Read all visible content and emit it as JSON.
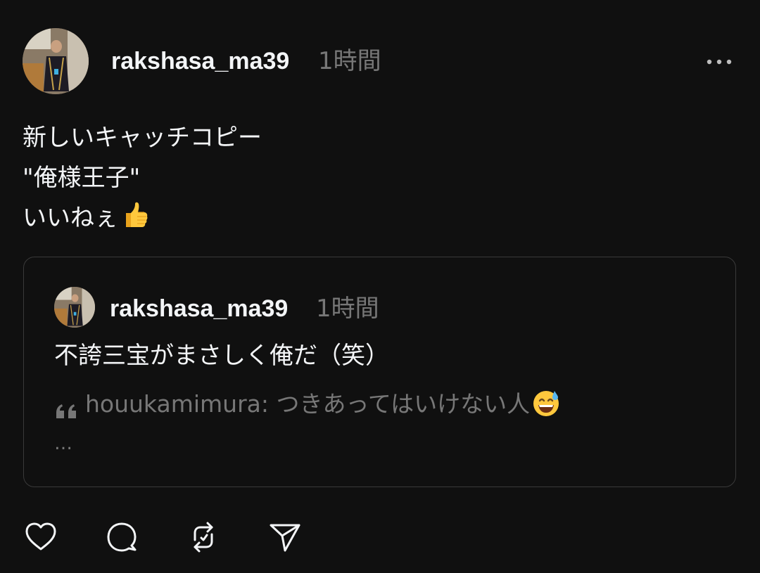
{
  "post": {
    "username": "rakshasa_ma39",
    "time": "1時間",
    "more_icon": "more-horizontal-icon",
    "body_lines": [
      "新しいキャッチコピー",
      "\"俺様王子\"",
      "いいねぇ"
    ],
    "body_emoji": "thumbs-up-emoji",
    "quoted": {
      "username": "rakshasa_ma39",
      "time": "1時間",
      "text": "不誇三宝がまさしく俺だ（笑）",
      "reply_author": "houukamimura:",
      "reply_text": "つきあってはいけない人",
      "reply_emoji": "grinning-sweat-emoji",
      "ellipsis": "…"
    },
    "actions": [
      {
        "name": "like",
        "icon": "heart-icon"
      },
      {
        "name": "reply",
        "icon": "comment-icon"
      },
      {
        "name": "repost",
        "icon": "repost-icon"
      },
      {
        "name": "share",
        "icon": "send-icon"
      }
    ]
  },
  "colors": {
    "background": "#101010",
    "text_primary": "#f3f5f7",
    "text_secondary": "#777777",
    "border": "#3a3a3a"
  }
}
